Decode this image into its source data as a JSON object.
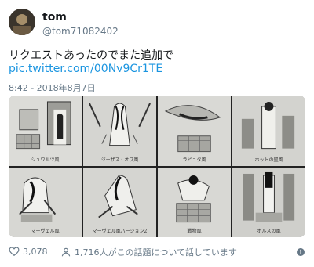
{
  "user": {
    "name": "tom",
    "handle": "@tom71082402"
  },
  "tweet": {
    "text": "リクエストあったのでまた追加で",
    "link": "pic.twitter.com/00Nv9Cr1TE",
    "timestamp": "8:42 - 2018年8月7日"
  },
  "images": {
    "captions": [
      "シュワルツ風",
      "ジーザス・オブ風",
      "ラピュタ風",
      "ホットの聖風",
      "マーヴェル風",
      "マーヴェル風バージョン2",
      "戦物風",
      "ホルスの風"
    ]
  },
  "actions": {
    "likes": "3,078",
    "discussion": "1,716人がこの話題について話しています"
  },
  "icons": {
    "like": "heart-icon",
    "discussion": "person-icon",
    "info": "info-icon"
  },
  "colors": {
    "link": "#1b95e0",
    "secondary_text": "#657786"
  }
}
